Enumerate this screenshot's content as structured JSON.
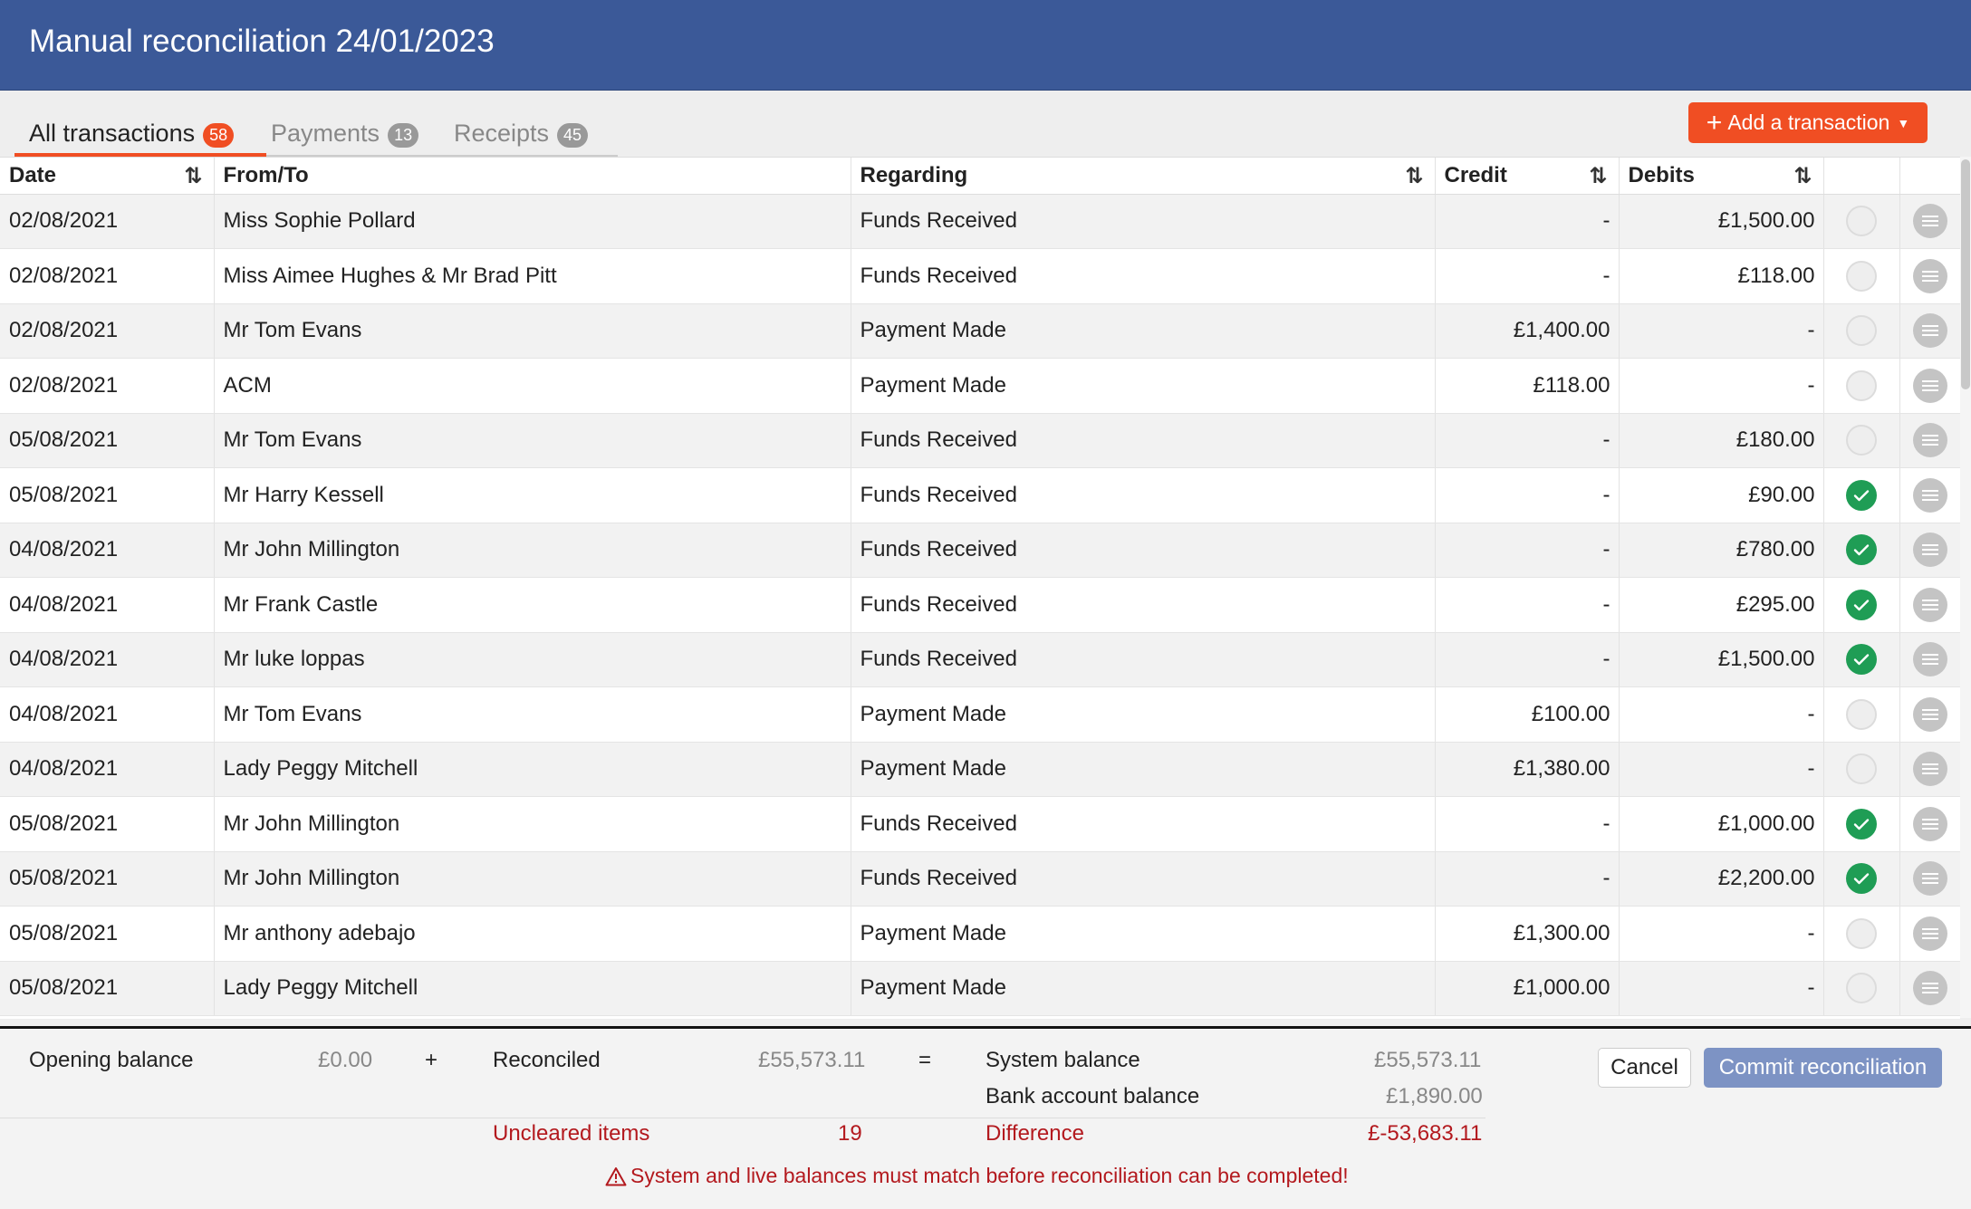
{
  "header": {
    "title": "Manual reconciliation 24/01/2023"
  },
  "tabs": [
    {
      "label": "All transactions",
      "count": "58",
      "active": true
    },
    {
      "label": "Payments",
      "count": "13",
      "active": false
    },
    {
      "label": "Receipts",
      "count": "45",
      "active": false
    }
  ],
  "toolbar": {
    "add_label": "Add a transaction"
  },
  "table": {
    "columns": [
      "Date",
      "From/To",
      "Regarding",
      "Credit",
      "Debits"
    ],
    "rows": [
      {
        "date": "02/08/2021",
        "from": "Miss Sophie Pollard",
        "regarding": "Funds Received",
        "credit": "-",
        "debit": "£1,500.00",
        "reconciled": false
      },
      {
        "date": "02/08/2021",
        "from": "Miss Aimee Hughes & Mr Brad Pitt",
        "regarding": "Funds Received",
        "credit": "-",
        "debit": "£118.00",
        "reconciled": false
      },
      {
        "date": "02/08/2021",
        "from": "Mr Tom Evans",
        "regarding": "Payment Made",
        "credit": "£1,400.00",
        "debit": "-",
        "reconciled": false
      },
      {
        "date": "02/08/2021",
        "from": "ACM",
        "regarding": "Payment Made",
        "credit": "£118.00",
        "debit": "-",
        "reconciled": false
      },
      {
        "date": "05/08/2021",
        "from": "Mr Tom Evans",
        "regarding": "Funds Received",
        "credit": "-",
        "debit": "£180.00",
        "reconciled": false
      },
      {
        "date": "05/08/2021",
        "from": "Mr Harry Kessell",
        "regarding": "Funds Received",
        "credit": "-",
        "debit": "£90.00",
        "reconciled": true
      },
      {
        "date": "04/08/2021",
        "from": "Mr John Millington",
        "regarding": "Funds Received",
        "credit": "-",
        "debit": "£780.00",
        "reconciled": true
      },
      {
        "date": "04/08/2021",
        "from": "Mr Frank Castle",
        "regarding": "Funds Received",
        "credit": "-",
        "debit": "£295.00",
        "reconciled": true
      },
      {
        "date": "04/08/2021",
        "from": "Mr luke loppas",
        "regarding": "Funds Received",
        "credit": "-",
        "debit": "£1,500.00",
        "reconciled": true
      },
      {
        "date": "04/08/2021",
        "from": "Mr Tom Evans",
        "regarding": "Payment Made",
        "credit": "£100.00",
        "debit": "-",
        "reconciled": false
      },
      {
        "date": "04/08/2021",
        "from": "Lady Peggy Mitchell",
        "regarding": "Payment Made",
        "credit": "£1,380.00",
        "debit": "-",
        "reconciled": false
      },
      {
        "date": "05/08/2021",
        "from": "Mr John Millington",
        "regarding": "Funds Received",
        "credit": "-",
        "debit": "£1,000.00",
        "reconciled": true
      },
      {
        "date": "05/08/2021",
        "from": "Mr John Millington",
        "regarding": "Funds Received",
        "credit": "-",
        "debit": "£2,200.00",
        "reconciled": true
      },
      {
        "date": "05/08/2021",
        "from": "Mr anthony adebajo",
        "regarding": "Payment Made",
        "credit": "£1,300.00",
        "debit": "-",
        "reconciled": false
      },
      {
        "date": "05/08/2021",
        "from": "Lady Peggy Mitchell",
        "regarding": "Payment Made",
        "credit": "£1,000.00",
        "debit": "-",
        "reconciled": false
      }
    ]
  },
  "summary": {
    "opening_label": "Opening balance",
    "opening_value": "£0.00",
    "plus": "+",
    "reconciled_label": "Reconciled",
    "reconciled_value": "£55,573.11",
    "equals": "=",
    "system_label": "System balance",
    "system_value": "£55,573.11",
    "bank_label": "Bank account balance",
    "bank_value": "£1,890.00",
    "uncleared_label": "Uncleared items",
    "uncleared_value": "19",
    "difference_label": "Difference",
    "difference_value": "£-53,683.11",
    "warning": "System and live balances must match before reconciliation can be completed!"
  },
  "actions": {
    "cancel_label": "Cancel",
    "commit_label": "Commit reconciliation"
  },
  "colors": {
    "header": "#3b5998",
    "accent": "#f04e23",
    "success": "#1f9d55",
    "error": "#b3191e",
    "commit": "#7d93c4"
  }
}
